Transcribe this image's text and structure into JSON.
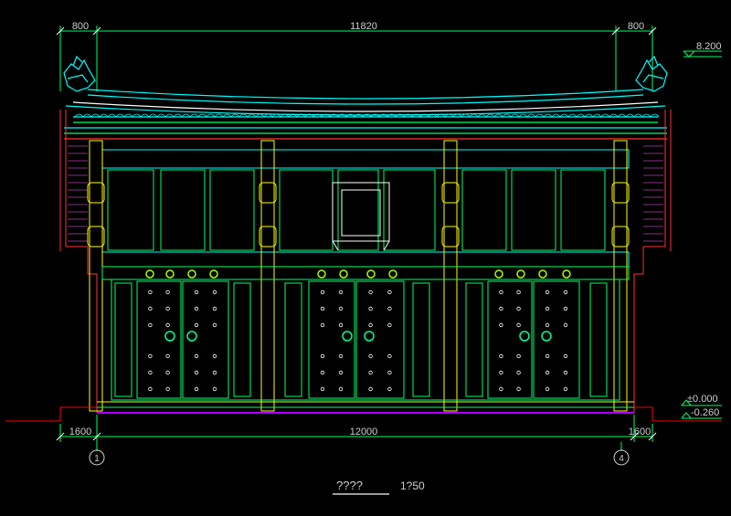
{
  "dimensions": {
    "top_left": "800",
    "top_middle": "11820",
    "top_right": "800",
    "bottom_left": "1600",
    "bottom_middle": "12000",
    "bottom_right": "1600"
  },
  "elevations": {
    "ridge": "8.200",
    "ground": "±0.000",
    "base": "-0.260"
  },
  "grid_axes": {
    "left": "1",
    "right": "4"
  },
  "title": {
    "name": "????",
    "scale": "1?50"
  },
  "colors": {
    "background": "#000000",
    "dimension": "#cfcfcf",
    "roof": "#00ffff",
    "wall": "#00ff66",
    "columns": "#ffff00",
    "ground": "#ff0000",
    "plinth": "#aa00ff",
    "ornament": "#ffffff"
  }
}
